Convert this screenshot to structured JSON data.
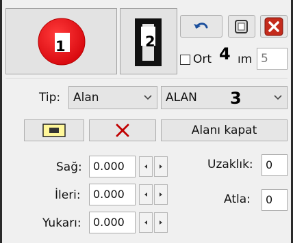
{
  "markers": {
    "m1": "1",
    "m2": "2",
    "m3": "3",
    "m4": "4"
  },
  "toolbar": {
    "undo_icon": "undo-arrow-icon",
    "maximize_icon": "window-square-icon",
    "close_icon": "close-x-icon",
    "close_color": "#c42b1c",
    "ortho_label_left": "Ort",
    "ortho_label_right": "ım",
    "ortho_checked": false,
    "ortho_value": "5"
  },
  "selectors": {
    "tip_label": "Tip:",
    "tip_value": "Alan",
    "type_value": "ALAN"
  },
  "actions": {
    "close_area_label": "Alanı kapat",
    "delete_icon_color": "#c00000"
  },
  "fields": {
    "sag_label": "Sağ:",
    "sag_value": "0.000",
    "ileri_label": "İleri:",
    "ileri_value": "0.000",
    "yukari_label": "Yukarı:",
    "yukari_value": "0.000",
    "uzaklik_label": "Uzaklık:",
    "uzaklik_value": "0",
    "atla_label": "Atla:",
    "atla_value": "0"
  },
  "colors": {
    "red_circle": "#e8121b",
    "panel": "#f0f0f0"
  }
}
